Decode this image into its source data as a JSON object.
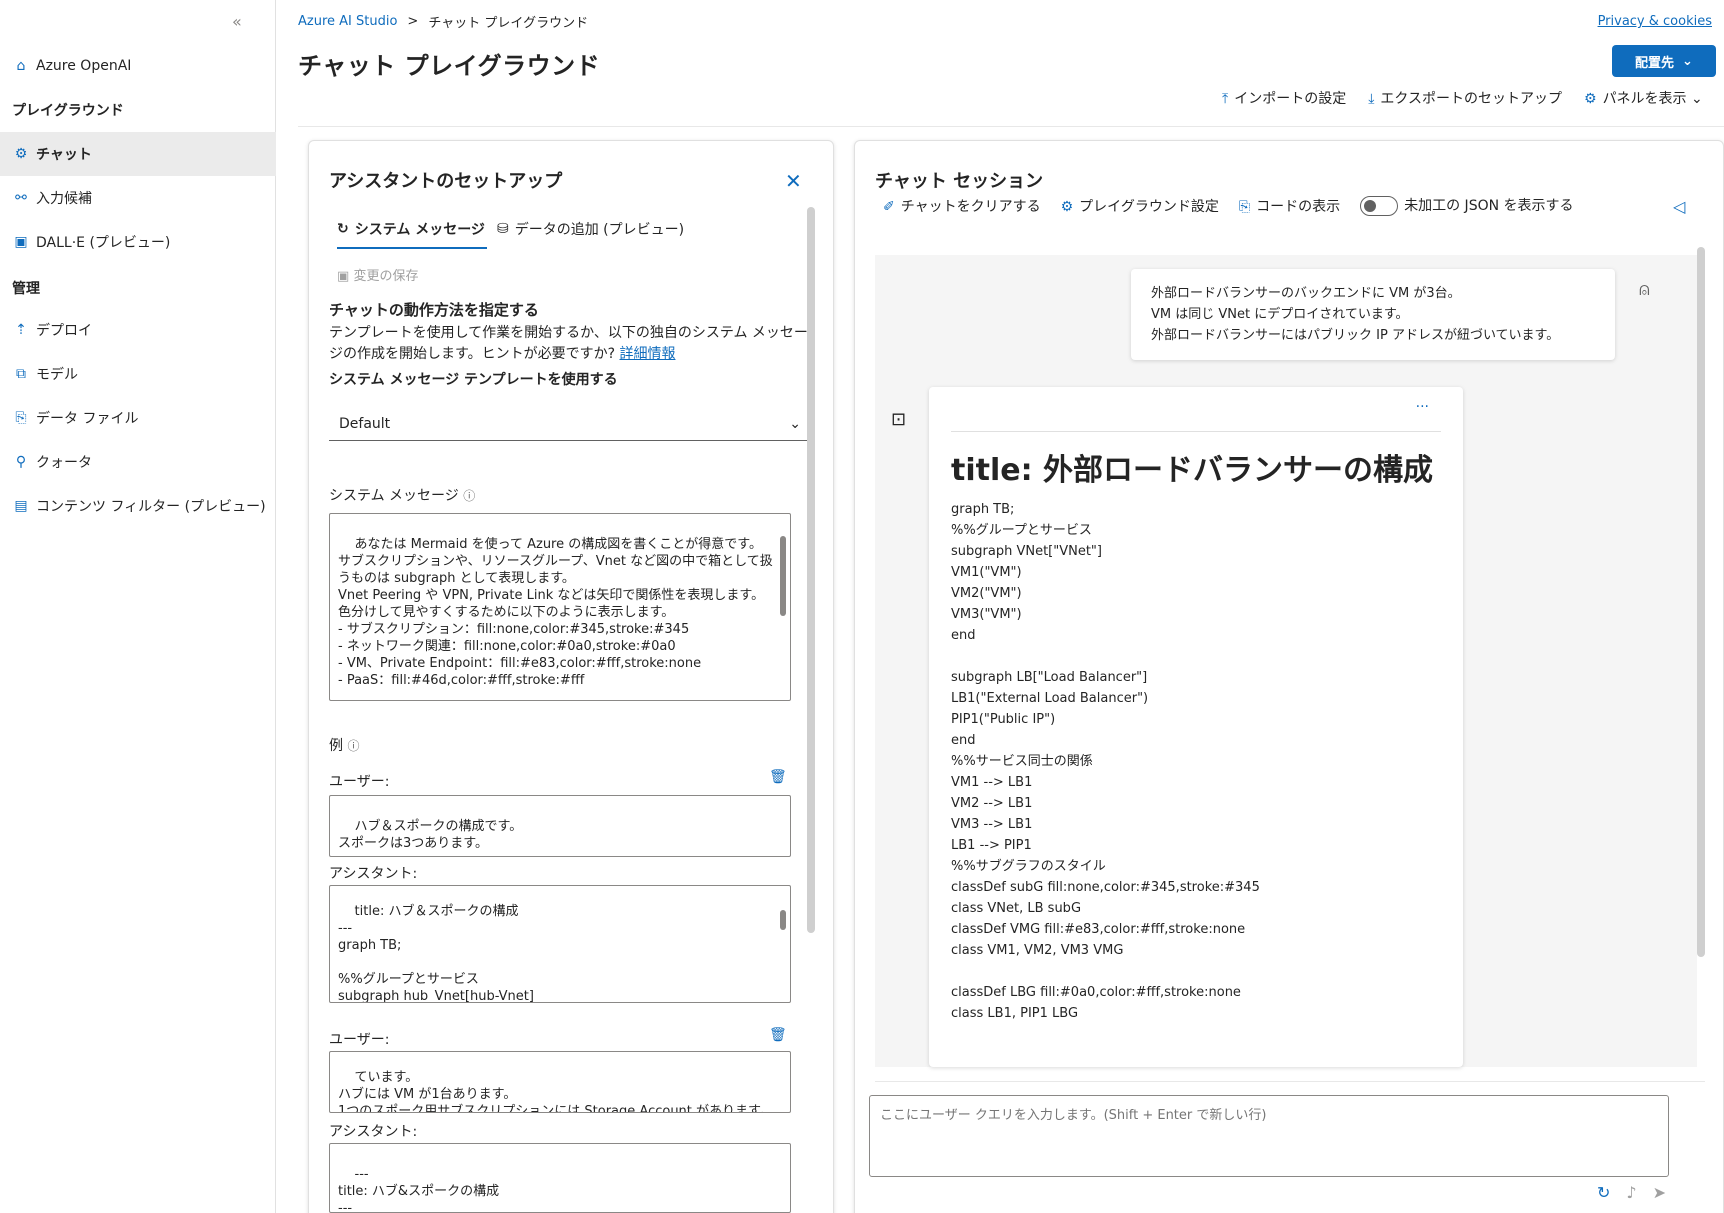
{
  "sidebar": {
    "collapse_icon": "«",
    "items": [
      {
        "label": "Azure OpenAI",
        "icon": "home-icon",
        "glyph": "⌂"
      },
      {
        "heading": "プレイグラウンド"
      },
      {
        "label": "チャット",
        "icon": "chat-icon",
        "glyph": "⚙",
        "active": true
      },
      {
        "label": "入力候補",
        "icon": "completions-icon",
        "glyph": "⚯"
      },
      {
        "label": "DALL·E (プレビュー)",
        "icon": "image-icon",
        "glyph": "▣"
      },
      {
        "heading": "管理"
      },
      {
        "label": "デプロイ",
        "icon": "deploy-icon",
        "glyph": "⇡"
      },
      {
        "label": "モデル",
        "icon": "model-icon",
        "glyph": "⧉"
      },
      {
        "label": "データ ファイル",
        "icon": "data-file-icon",
        "glyph": "⎘"
      },
      {
        "label": "クォータ",
        "icon": "quota-icon",
        "glyph": "⚲"
      },
      {
        "label": "コンテンツ フィルター (プレビュー)",
        "icon": "filter-icon",
        "glyph": "▤"
      }
    ]
  },
  "header": {
    "breadcrumb_root": "Azure AI Studio",
    "breadcrumb_sep": ">",
    "breadcrumb_current": "チャット プレイグラウンド",
    "title": "チャット プレイグラウンド",
    "privacy": "Privacy & cookies",
    "deploy_label": "配置先",
    "toolbar": {
      "import": "インポートの設定",
      "export": "エクスポートのセットアップ",
      "panels": "パネルを表示"
    }
  },
  "assistant": {
    "title": "アシスタントのセットアップ",
    "tab_system": "システム メッセージ",
    "tab_data": "データの追加 (プレビュー)",
    "save_changes": "変更の保存",
    "behavior_heading": "チャットの動作方法を指定する",
    "behavior_text": "テンプレートを使用して作業を開始するか、以下の独自のシステム メッセージの作成を開始します。ヒントが必要ですか?",
    "behavior_link": "詳細情報",
    "template_label": "システム メッセージ テンプレートを使用する",
    "template_value": "Default",
    "system_message_label": "システム メッセージ",
    "system_message": "あなたは Mermaid を使って Azure の構成図を書くことが得意です。\nサブスクリプションや、リソースグループ、Vnet など図の中で箱として扱うものは subgraph として表現します。\nVnet Peering や VPN, Private Link などは矢印で関係性を表現します。\n色分けして見やすくするために以下のように表示します。\n- サブスクリプション：fill:none,color:#345,stroke:#345\n- ネットワーク関連：fill:none,color:#0a0,stroke:#0a0\n- VM、Private Endpoint：fill:#e83,color:#fff,stroke:none\n- PaaS：fill:#46d,color:#fff,stroke:#fff",
    "examples_label": "例",
    "user_label": "ユーザー:",
    "assistant_label": "アシスタント:",
    "example1_user": "ハブ＆スポークの構成です。\nスポークは3つあります。",
    "example1_assistant": "title: ハブ＆スポークの構成\n---\ngraph TB;\n\n%%グループとサービス\nsubgraph hub_Vnet[hub-Vnet]\nend",
    "example2_user": "ています。\nハブには VM が1台あります。\n1つのスポーク用サブスクリプションには Storage Account があります。",
    "example2_assistant": "---\ntitle: ハブ&スポークの構成\n---"
  },
  "chat": {
    "title": "チャット セッション",
    "clear": "チャットをクリアする",
    "settings": "プレイグラウンド設定",
    "code": "コードの表示",
    "json_toggle": "未加工の JSON を表示する",
    "user_message": [
      "外部ロードバランサーのバックエンドに VM が3台。",
      "VM は同じ VNet にデプロイされています。",
      "外部ロードバランサーにはパブリック IP アドレスが紐づいています。"
    ],
    "bot_more": "···",
    "bot_title": "title: 外部ロードバランサーの構成",
    "bot_lines": [
      "graph TB;",
      "%%グループとサービス",
      "subgraph VNet[\"VNet\"]",
      "VM1(\"VM\")",
      "VM2(\"VM\")",
      "VM3(\"VM\")",
      "end",
      "",
      "subgraph LB[\"Load Balancer\"]",
      "LB1(\"External Load Balancer\")",
      "PIP1(\"Public IP\")",
      "end",
      "%%サービス同士の関係",
      "VM1 --> LB1",
      "VM2 --> LB1",
      "VM3 --> LB1",
      "LB1 --> PIP1",
      "%%サブグラフのスタイル",
      "classDef subG fill:none,color:#345,stroke:#345",
      "class VNet, LB subG",
      "classDef VMG fill:#e83,color:#fff,stroke:none",
      "class VM1, VM2, VM3 VMG",
      "",
      "classDef LBG fill:#0a0,color:#fff,stroke:none",
      "class LB1, PIP1 LBG"
    ],
    "input_placeholder": "ここにユーザー クエリを入力します。(Shift + Enter で新しい行)"
  },
  "colors": {
    "accent": "#0f6cbd",
    "sidebar_active_bg": "#ebebeb",
    "chat_bg": "#f5f5f5"
  }
}
